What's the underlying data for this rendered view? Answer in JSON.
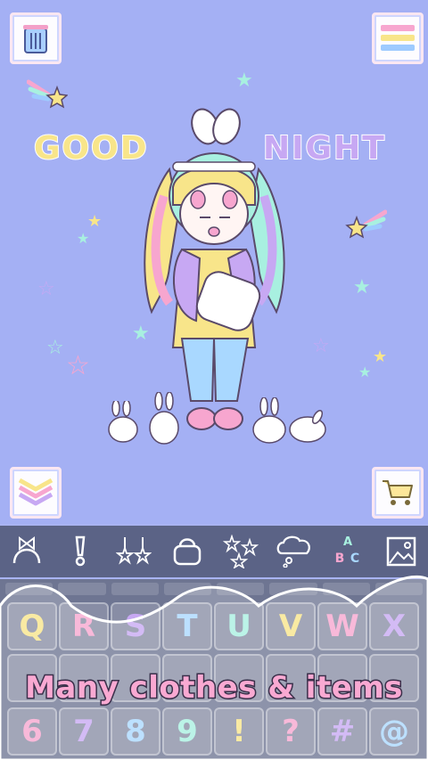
{
  "scene": {
    "title_left": "GOOD",
    "title_right": "NIGHT"
  },
  "buttons": {
    "trash": "trash-icon",
    "menu": "hamburger-menu-icon",
    "collapse": "chevron-down-icon",
    "shop": "shopping-cart-icon"
  },
  "toolbar": {
    "items": [
      {
        "icon": "headband-icon"
      },
      {
        "icon": "earring-icon"
      },
      {
        "icon": "star-earrings-icon"
      },
      {
        "icon": "bag-icon"
      },
      {
        "icon": "sparkles-icon"
      },
      {
        "icon": "speech-bubble-icon"
      },
      {
        "icon": "letters-icon",
        "label": "A B C"
      },
      {
        "icon": "background-image-icon"
      }
    ]
  },
  "keys": {
    "row1": [
      "Q",
      "R",
      "S",
      "T",
      "U",
      "V",
      "W",
      "X"
    ],
    "row3": [
      "6",
      "7",
      "8",
      "9",
      "!",
      "?",
      "#",
      "@"
    ]
  },
  "caption": "Many clothes & items",
  "colors": {
    "background": "#a4b0f4",
    "toolbar": "#5b6386",
    "pink": "#f7a6cf",
    "yellow": "#f8e58a",
    "blue": "#a9d8ff",
    "purple": "#c7a8f3",
    "mint": "#a8f0e0"
  }
}
